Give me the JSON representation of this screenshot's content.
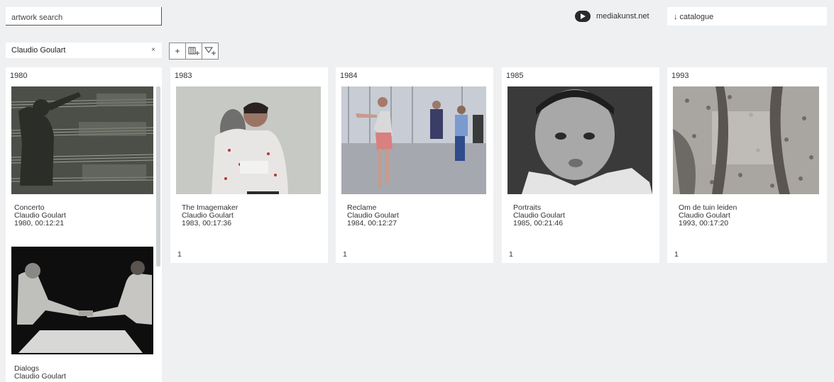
{
  "header": {
    "search_label": "artwork search",
    "brand": "mediakunst.net",
    "catalogue_label": "↓  catalogue"
  },
  "filter": {
    "value": "Claudio Goulart",
    "clear": "×"
  },
  "toolbar": {
    "add": "+",
    "columns": "Ⅲ",
    "filter": "▽"
  },
  "columns": [
    {
      "year": "1980",
      "items": [
        {
          "title": "Concerto",
          "artist": "Claudio Goulart",
          "info": "1980, 00:12:21"
        },
        {
          "title": "Dialogs",
          "artist": "Claudio Goulart",
          "info": ""
        }
      ]
    },
    {
      "year": "1983",
      "items": [
        {
          "title": "The Imagemaker",
          "artist": "Claudio Goulart",
          "info": "1983, 00:17:36"
        }
      ],
      "count": "1"
    },
    {
      "year": "1984",
      "items": [
        {
          "title": "Reclame",
          "artist": "Claudio Goulart",
          "info": "1984, 00:12:27"
        }
      ],
      "count": "1"
    },
    {
      "year": "1985",
      "items": [
        {
          "title": "Portraits",
          "artist": "Claudio Goulart",
          "info": "1985, 00:21:46"
        }
      ],
      "count": "1"
    },
    {
      "year": "1993",
      "items": [
        {
          "title": "Om de tuin leiden",
          "artist": "Claudio Goulart",
          "info": "1993, 00:17:20"
        }
      ],
      "count": "1"
    }
  ]
}
